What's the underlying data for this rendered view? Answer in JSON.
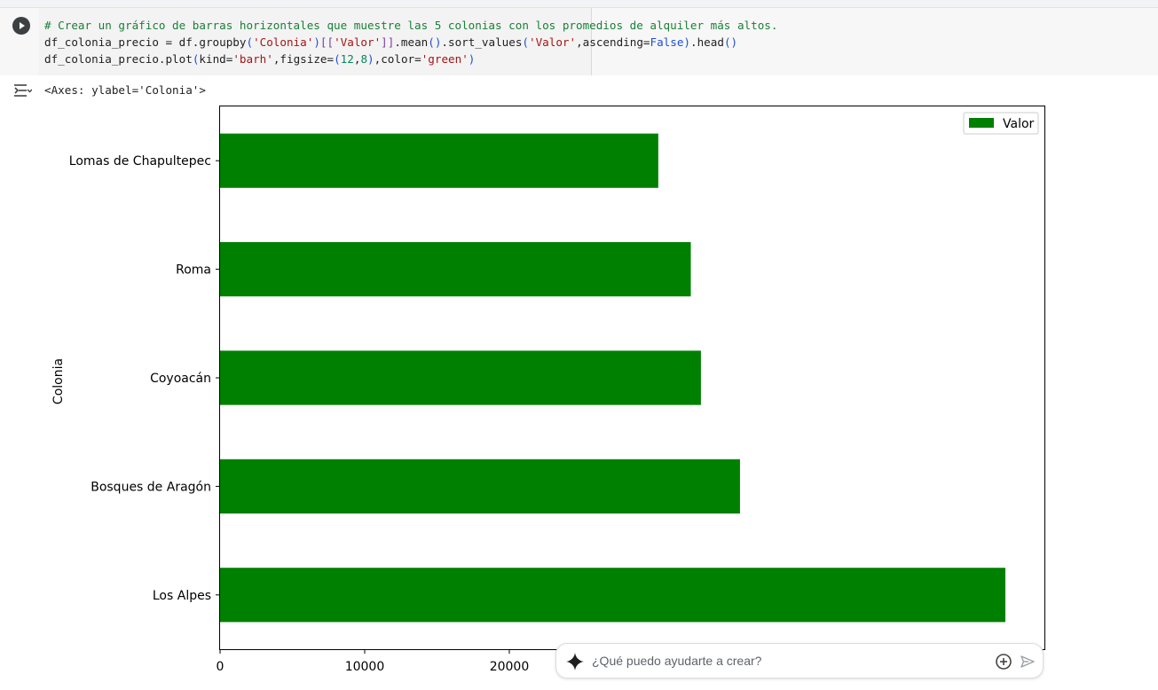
{
  "cell": {
    "code_lines": [
      [
        {
          "t": "# Crear un gráfico de barras horizontales que muestre las 5 colonias con los promedios de alquiler más altos.",
          "c": "c-comment"
        }
      ],
      [
        {
          "t": "df_colonia_precio = df.groupby"
        },
        {
          "t": "(",
          "c": "c-paren"
        },
        {
          "t": "'Colonia'",
          "c": "c-str"
        },
        {
          "t": ")",
          "c": "c-paren"
        },
        {
          "t": "[[",
          "c": "c-bracket"
        },
        {
          "t": "'Valor'",
          "c": "c-str"
        },
        {
          "t": "]]",
          "c": "c-bracket"
        },
        {
          "t": ".mean"
        },
        {
          "t": "()",
          "c": "c-paren"
        },
        {
          "t": ".sort_values"
        },
        {
          "t": "(",
          "c": "c-paren"
        },
        {
          "t": "'Valor'",
          "c": "c-str"
        },
        {
          "t": ",ascending="
        },
        {
          "t": "False",
          "c": "c-bool"
        },
        {
          "t": ")",
          "c": "c-paren"
        },
        {
          "t": ".head"
        },
        {
          "t": "()",
          "c": "c-paren"
        }
      ],
      [
        {
          "t": "df_colonia_precio.plot"
        },
        {
          "t": "(",
          "c": "c-paren"
        },
        {
          "t": "kind="
        },
        {
          "t": "'barh'",
          "c": "c-str"
        },
        {
          "t": ",figsize="
        },
        {
          "t": "(",
          "c": "c-paren"
        },
        {
          "t": "12",
          "c": "c-num"
        },
        {
          "t": ","
        },
        {
          "t": "8",
          "c": "c-num"
        },
        {
          "t": ")",
          "c": "c-paren"
        },
        {
          "t": ",color="
        },
        {
          "t": "'green'",
          "c": "c-str"
        },
        {
          "t": ")",
          "c": "c-paren"
        }
      ]
    ]
  },
  "output": {
    "text": "<Axes: ylabel='Colonia'>"
  },
  "chart_data": {
    "type": "bar",
    "orientation": "horizontal",
    "categories": [
      "Los Alpes",
      "Bosques de Aragón",
      "Coyoacán",
      "Roma",
      "Lomas de Chapultepec"
    ],
    "series": [
      {
        "name": "Valor",
        "values": [
          54300,
          35950,
          33250,
          32550,
          30300
        ],
        "color": "#008000"
      }
    ],
    "xticks": [
      0,
      10000,
      20000
    ],
    "xtick_labels": [
      "0",
      "10000",
      "20000"
    ],
    "xlim": [
      0,
      57000
    ],
    "ylabel": "Colonia",
    "legend": "top-right",
    "grid": false
  },
  "assistant": {
    "placeholder": "¿Qué puedo ayudarte a crear?",
    "spark_icon": "gemini-spark-icon",
    "add_icon": "add-circle-icon",
    "send_icon": "send-icon"
  }
}
